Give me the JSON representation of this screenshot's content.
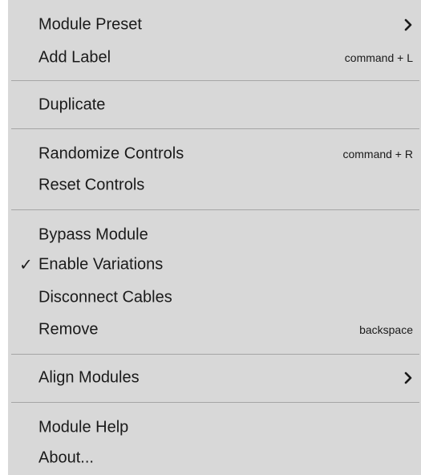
{
  "menu": {
    "items": [
      {
        "label": "Module Preset",
        "submenu_icon": "chevron-right-icon"
      },
      {
        "label": "Add Label",
        "shortcut": "command + L"
      },
      {
        "label": "Duplicate"
      },
      {
        "label": "Randomize Controls",
        "shortcut": "command + R"
      },
      {
        "label": "Reset Controls"
      },
      {
        "label": "Bypass Module"
      },
      {
        "label": "Enable Variations",
        "checked": true,
        "check_glyph": "✓"
      },
      {
        "label": "Disconnect Cables"
      },
      {
        "label": "Remove",
        "shortcut": "backspace"
      },
      {
        "label": "Align Modules",
        "submenu_icon": "chevron-right-icon"
      },
      {
        "label": "Module Help"
      },
      {
        "label": "About..."
      }
    ]
  },
  "colors": {
    "menu_background": "#d8d8d8",
    "separator": "#a5a5a5",
    "text": "#1a1a1a"
  }
}
